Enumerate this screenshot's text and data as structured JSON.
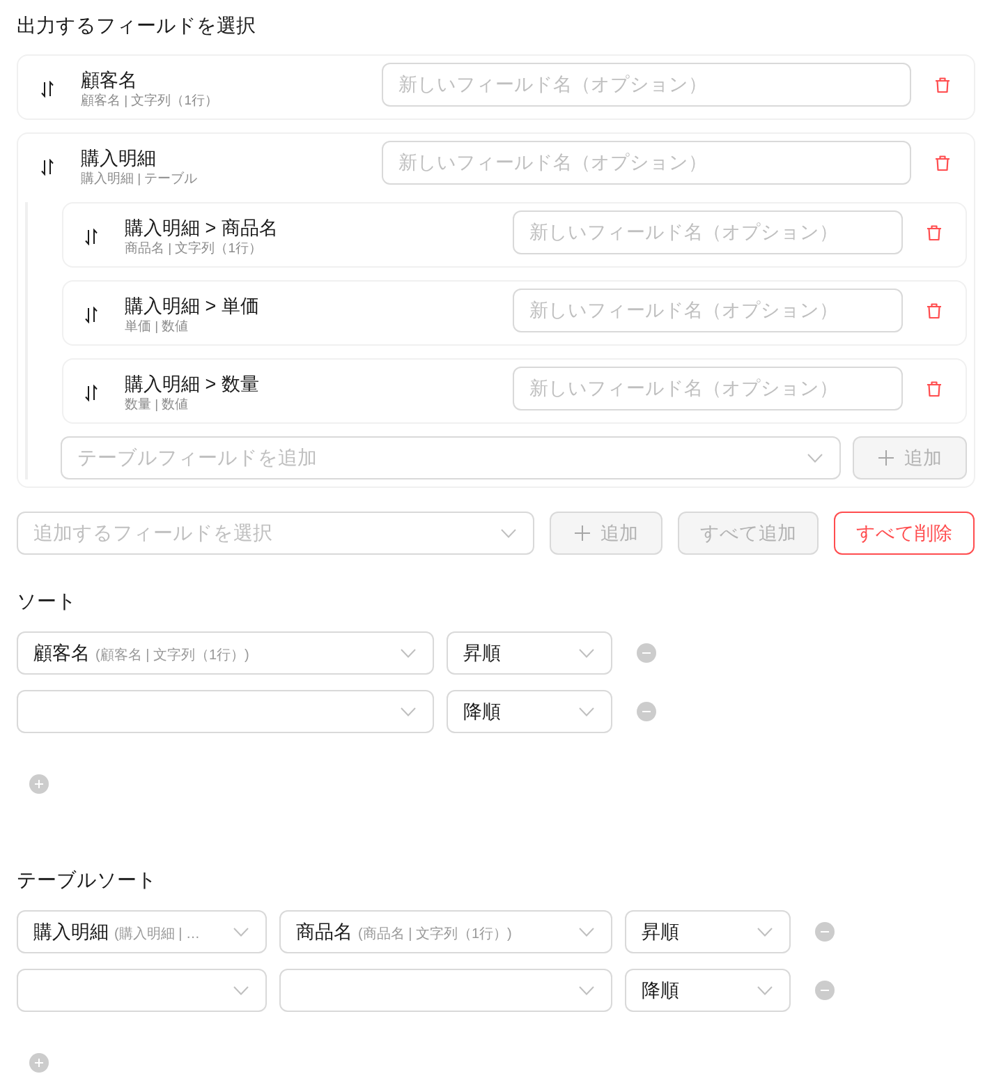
{
  "output_fields": {
    "title": "出力するフィールドを選択",
    "fields": [
      {
        "name": "顧客名",
        "meta": "顧客名 | 文字列（1行）",
        "rename": {
          "placeholder": "新しいフィールド名（オプション）"
        }
      },
      {
        "name": "購入明細",
        "meta": "購入明細 | テーブル",
        "rename": {
          "placeholder": "新しいフィールド名（オプション）"
        },
        "children": [
          {
            "name": "購入明細 > 商品名",
            "meta": "商品名 | 文字列（1行）",
            "rename": {
              "placeholder": "新しいフィールド名（オプション）"
            }
          },
          {
            "name": "購入明細 > 単価",
            "meta": "単価 | 数値",
            "rename": {
              "placeholder": "新しいフィールド名（オプション）"
            }
          },
          {
            "name": "購入明細 > 数量",
            "meta": "数量 | 数値",
            "rename": {
              "placeholder": "新しいフィールド名（オプション）"
            }
          }
        ],
        "add_child": {
          "select": {
            "placeholder": "テーブルフィールドを追加"
          },
          "button": {
            "kind": "add",
            "label": "追加",
            "disabled": true,
            "danger": false
          }
        }
      }
    ],
    "add_field": {
      "select": {
        "placeholder": "追加するフィールドを選択"
      },
      "buttons": [
        {
          "kind": "add",
          "label": "追加",
          "disabled": true,
          "danger": false
        },
        {
          "kind": "text",
          "label": "すべて追加",
          "disabled": true,
          "danger": false
        },
        {
          "kind": "text",
          "label": "すべて削除",
          "disabled": false,
          "danger": true
        }
      ]
    }
  },
  "sort": {
    "title": "ソート",
    "rows": [
      {
        "field": {
          "value": "顧客名",
          "hint": "(顧客名 | 文字列（1行）)"
        },
        "order": {
          "value": "昇順"
        }
      },
      {
        "order": {
          "value": "降順"
        }
      }
    ]
  },
  "table_sort": {
    "title": "テーブルソート",
    "rows": [
      {
        "table": {
          "value": "購入明細",
          "hint": "(購入明細 | …"
        },
        "field": {
          "value": "商品名",
          "hint": "(商品名 | 文字列（1行）)"
        },
        "order": {
          "value": "昇順"
        }
      },
      {
        "order": {
          "value": "降順"
        }
      }
    ]
  }
}
